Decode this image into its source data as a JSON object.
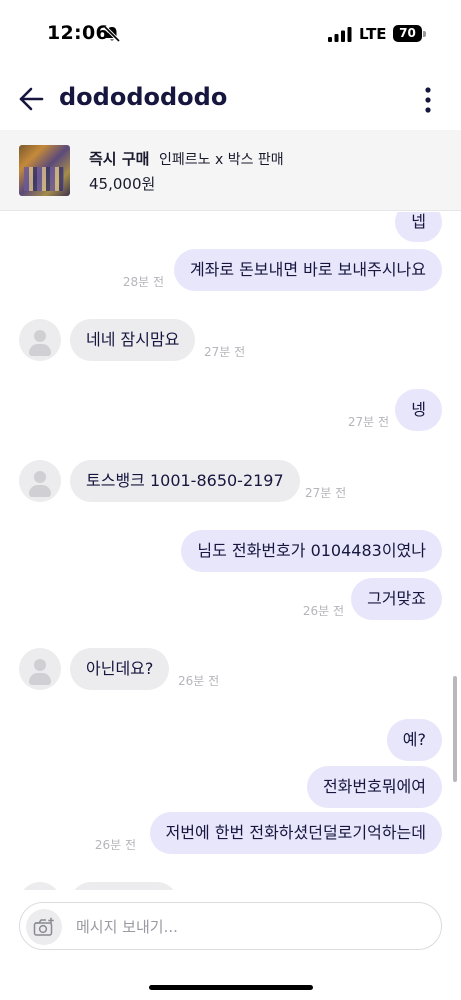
{
  "status_bar": {
    "time": "12:06",
    "network": "LTE",
    "battery": "70",
    "icons": [
      "bell-slash-icon",
      "signal-icon",
      "battery-icon"
    ]
  },
  "header": {
    "title": "dododododo",
    "back_icon": "arrow-left-icon",
    "more_icon": "more-vertical-icon"
  },
  "product": {
    "status": "즉시 구매",
    "name": "인페르노 x 박스 판매",
    "price": "45,000원"
  },
  "messages": [
    {
      "side": "mine",
      "text": "넵"
    },
    {
      "side": "mine",
      "text": "계좌로 돈보내면 바로 보내주시나요",
      "time": "28분 전"
    },
    {
      "side": "theirs",
      "text": "네네 잠시맘요",
      "time": "27분 전"
    },
    {
      "side": "mine",
      "text": "넹",
      "time": "27분 전"
    },
    {
      "side": "theirs",
      "text": "토스뱅크 1001-8650-2197",
      "time": "27분 전"
    },
    {
      "side": "mine",
      "text": "님도 전화번호가 0104483이였나"
    },
    {
      "side": "mine",
      "text": "그거맞죠",
      "time": "26분 전"
    },
    {
      "side": "theirs",
      "text": "아닌데요?",
      "time": "26분 전"
    },
    {
      "side": "mine",
      "text": "예?"
    },
    {
      "side": "mine",
      "text": "전화번호뭐에여"
    },
    {
      "side": "mine",
      "text": "저번에 한번 전화하셨던덜로기억하는데",
      "time": "26분 전"
    }
  ],
  "composer": {
    "placeholder": "메시지 보내기...",
    "camera_icon": "camera-plus-icon"
  },
  "colors": {
    "my_bubble": "#e8e6fb",
    "their_bubble": "#ececee",
    "title": "#16163f"
  }
}
